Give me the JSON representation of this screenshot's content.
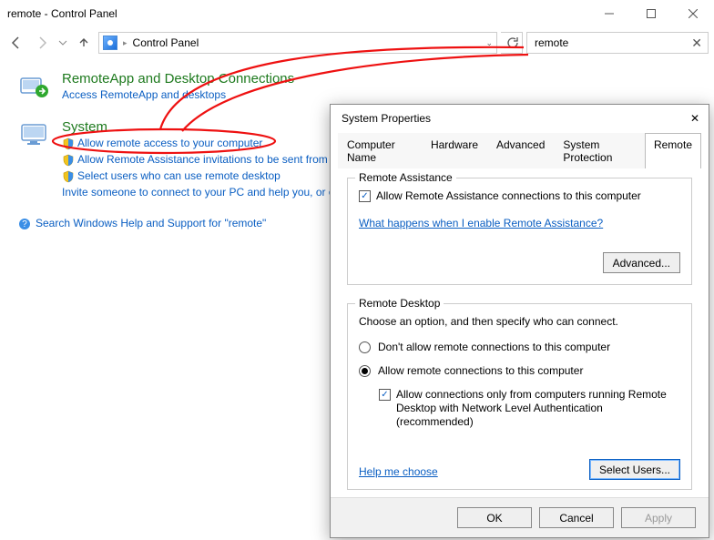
{
  "window": {
    "title": "remote - Control Panel",
    "breadcrumb_root": "Control Panel",
    "search_value": "remote"
  },
  "results": {
    "remoteapp": {
      "heading": "RemoteApp and Desktop Connections",
      "sub": "Access RemoteApp and desktops"
    },
    "system": {
      "heading": "System",
      "l1": "Allow remote access to your computer",
      "l2": "Allow Remote Assistance invitations to be sent from this computer",
      "l3": "Select users who can use remote desktop",
      "l4": "Invite someone to connect to your PC and help you, or offer to help someone else"
    },
    "help": "Search Windows Help and Support for \"remote\""
  },
  "dialog": {
    "title": "System Properties",
    "tabs": {
      "t1": "Computer Name",
      "t2": "Hardware",
      "t3": "Advanced",
      "t4": "System Protection",
      "t5": "Remote"
    },
    "ra": {
      "legend": "Remote Assistance",
      "allow": "Allow Remote Assistance connections to this computer",
      "what": "What happens when I enable Remote Assistance?",
      "advanced": "Advanced..."
    },
    "rd": {
      "legend": "Remote Desktop",
      "choose": "Choose an option, and then specify who can connect.",
      "opt_disallow": "Don't allow remote connections to this computer",
      "opt_allow": "Allow remote connections to this computer",
      "nla": "Allow connections only from computers running Remote Desktop with Network Level Authentication (recommended)",
      "help": "Help me choose",
      "select_users": "Select Users..."
    },
    "footer": {
      "ok": "OK",
      "cancel": "Cancel",
      "apply": "Apply"
    }
  }
}
